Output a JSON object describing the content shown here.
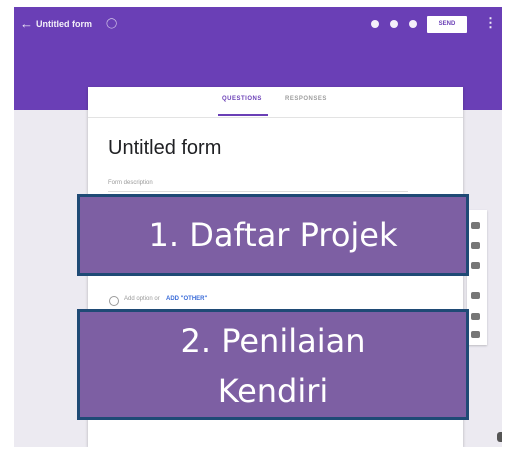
{
  "window": {
    "title": "Untitled form",
    "back_icon": "arrow-left-icon",
    "send_label": "SEND",
    "accent": "#6a3fb6"
  },
  "toolbar_icons": [
    "palette-icon",
    "preview-icon",
    "settings-icon",
    "more-vert-icon"
  ],
  "tabs": [
    {
      "label": "QUESTIONS",
      "active": true
    },
    {
      "label": "RESPONSES",
      "active": false
    }
  ],
  "form": {
    "title": "Untitled form",
    "description_placeholder": "Form description",
    "option_text": "Add option or",
    "option_link": "ADD \"OTHER\""
  },
  "side_tools": [
    "add-question-icon",
    "import-icon",
    "title-icon",
    "image-icon",
    "video-icon",
    "section-icon"
  ],
  "overlays": {
    "box1": "1. Daftar Projek",
    "box2_line1": "2. Penilaian",
    "box2_line2": "Kendiri",
    "fill": "#7d5fa3",
    "border": "#1f4a75"
  }
}
